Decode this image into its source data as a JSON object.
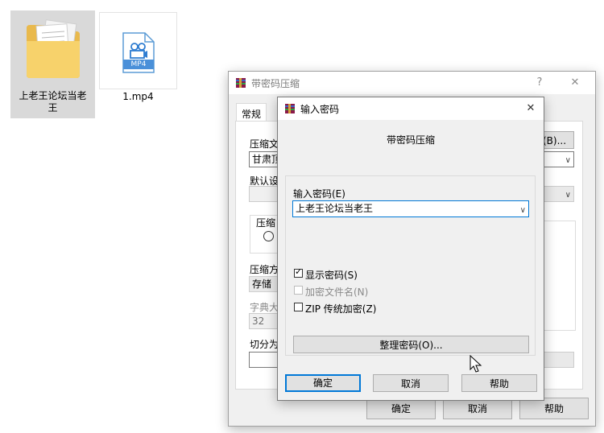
{
  "desktop": {
    "folder_label": "上老王论坛当老王",
    "file_label": "1.mp4",
    "file_badge": "MP4"
  },
  "back_dialog": {
    "title": "带密码压缩",
    "help_glyph": "?",
    "close_glyph": "✕",
    "tab_general": "常规",
    "archive_name_label": "压缩文",
    "archive_name_value": "甘肃顶",
    "browse_label": "(B)...",
    "default_profile_label": "默认设",
    "format_group_label": "压缩",
    "method_label": "压缩方",
    "method_value": "存储",
    "dict_label": "字典大",
    "dict_value": "32",
    "split_label": "切分为",
    "ok": "确定",
    "cancel": "取消",
    "help": "帮助"
  },
  "front_dialog": {
    "title": "输入密码",
    "close_glyph": "✕",
    "heading": "带密码压缩",
    "password_label": "输入密码(E)",
    "password_value": "上老王论坛当老王",
    "show_password": "显示密码(S)",
    "encrypt_names": "加密文件名(N)",
    "zip_legacy": "ZIP 传统加密(Z)",
    "organize_button": "整理密码(O)...",
    "ok": "确定",
    "cancel": "取消",
    "help": "帮助",
    "show_password_checked": true,
    "encrypt_names_checked": false,
    "zip_legacy_checked": false
  }
}
